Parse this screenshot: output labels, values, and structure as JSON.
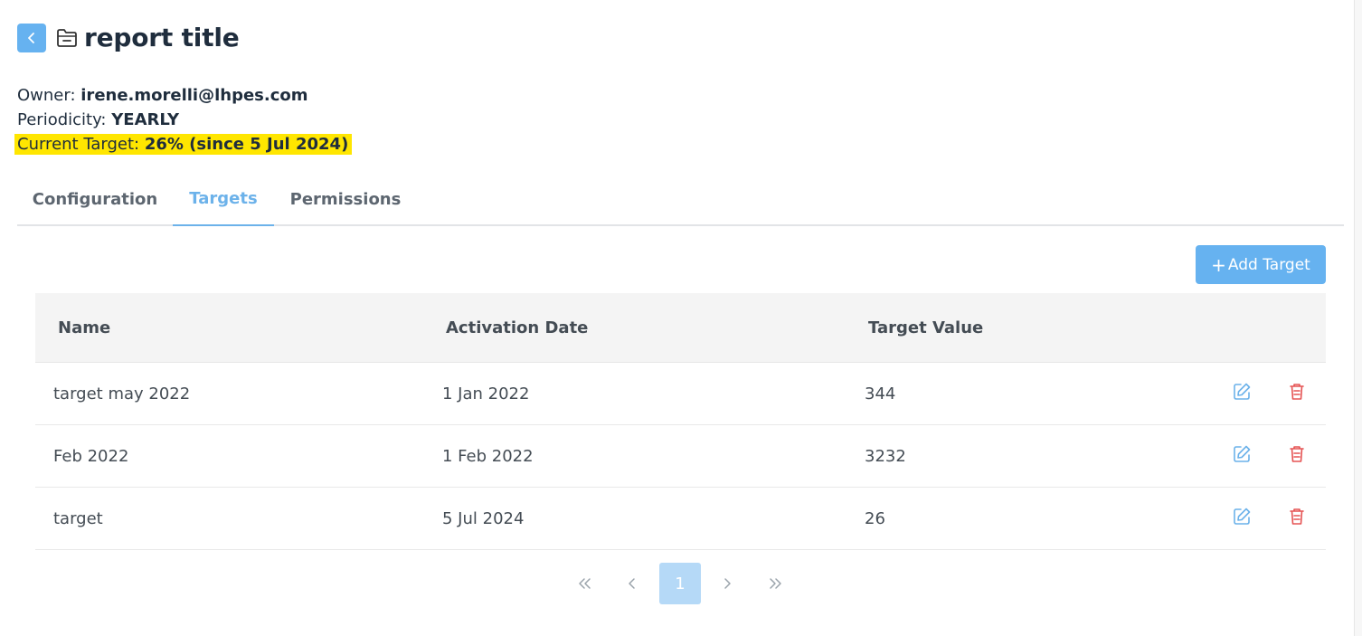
{
  "header": {
    "title": "report title",
    "back_icon": "chevron-left-icon",
    "folder_icon": "folder-icon"
  },
  "meta": {
    "owner_label": "Owner:",
    "owner_value": "irene.morelli@lhpes.com",
    "periodicity_label": "Periodicity:",
    "periodicity_value": "YEARLY",
    "target_label": "Current Target:",
    "target_value": "26% (since 5 Jul 2024)"
  },
  "tabs": [
    {
      "label": "Configuration",
      "active": false
    },
    {
      "label": "Targets",
      "active": true
    },
    {
      "label": "Permissions",
      "active": false
    }
  ],
  "add_button": {
    "plus": "+",
    "label": "Add Target"
  },
  "table": {
    "columns": [
      "Name",
      "Activation Date",
      "Target Value"
    ],
    "rows": [
      {
        "name": "target may 2022",
        "date": "1 Jan 2022",
        "value": "344"
      },
      {
        "name": "Feb 2022",
        "date": "1 Feb 2022",
        "value": "3232"
      },
      {
        "name": "target",
        "date": "5 Jul 2024",
        "value": "26"
      }
    ]
  },
  "pagination": {
    "current_page": "1"
  },
  "colors": {
    "accent": "#66b2f0",
    "highlight": "#ffe600",
    "delete": "#e55353",
    "edit": "#6cb2ea"
  }
}
